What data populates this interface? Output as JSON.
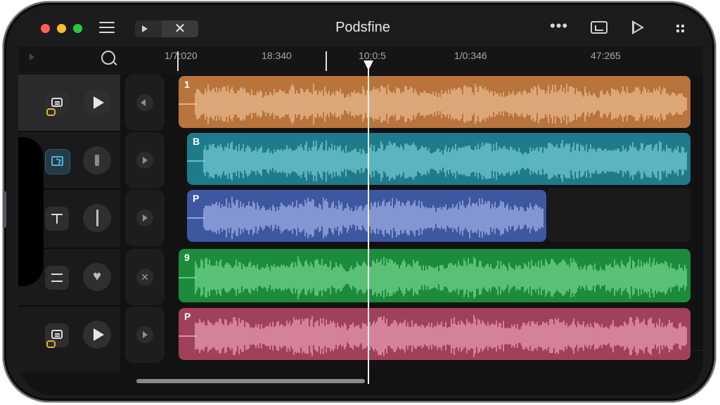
{
  "window": {
    "title": "Podsfine",
    "transport": {
      "play_icon": "play-icon",
      "close_label": "✕"
    },
    "toolbar": {
      "more_label": "•••"
    }
  },
  "ruler": {
    "labels": [
      "1/7:020",
      "18:340",
      "10:0:5",
      "1/0:346",
      "47:265"
    ]
  },
  "tracks": [
    {
      "label": "1",
      "color": "#b8743a",
      "wave": "#f1c69d",
      "icon": "chat-bubble-icon",
      "action": "play",
      "mute": "left"
    },
    {
      "label": "B",
      "color": "#1f7a8a",
      "wave": "#7fd6df",
      "icon": "monitor-icon",
      "action": "stop",
      "mute": "right"
    },
    {
      "label": "P",
      "color": "#3d57a0",
      "wave": "#aebcef",
      "icon": "text-tool-icon",
      "action": "pause",
      "mute": "right"
    },
    {
      "label": "9",
      "color": "#1c8b3c",
      "wave": "#7fe09a",
      "icon": "equalizer-icon",
      "action": "heart",
      "mute": "x"
    },
    {
      "label": "P",
      "color": "#a1405a",
      "wave": "#f2a9bf",
      "icon": "chat-bubble-icon",
      "action": "play",
      "mute": "right"
    }
  ]
}
